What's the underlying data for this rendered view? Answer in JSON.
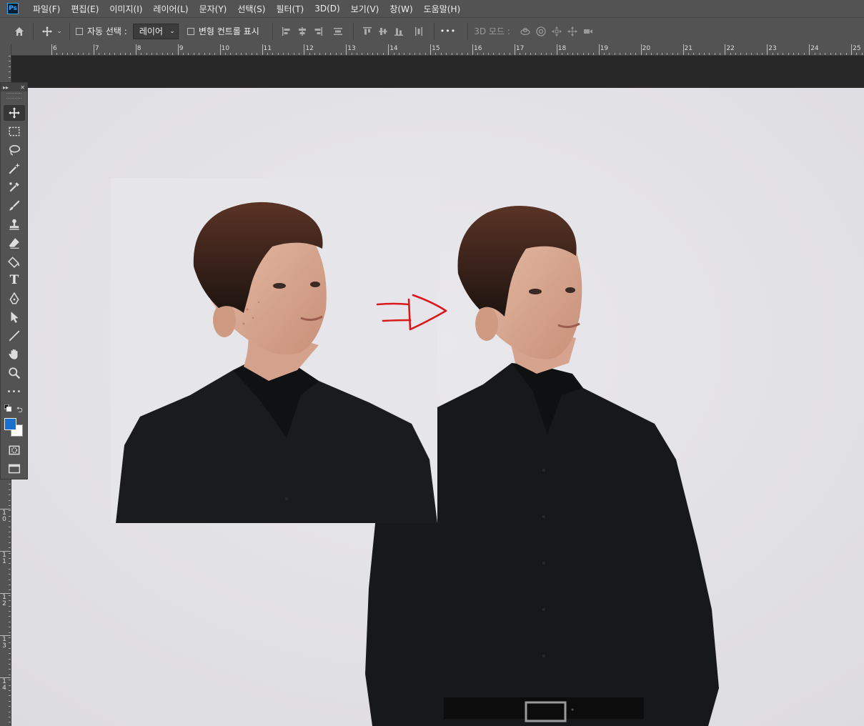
{
  "app": {
    "logo_text": "Ps"
  },
  "menu": [
    "파일(F)",
    "편집(E)",
    "이미지(I)",
    "레이어(L)",
    "문자(Y)",
    "선택(S)",
    "필터(T)",
    "3D(D)",
    "보기(V)",
    "창(W)",
    "도움말(H)"
  ],
  "options": {
    "auto_select_label": "자동 선택 :",
    "auto_select_value": "레이어",
    "transform_controls_label": "변형 컨트롤 표시",
    "mode_3d_label": "3D 모드 :",
    "more_label": "•••"
  },
  "ruler_top": [
    "6",
    "7",
    "8",
    "9",
    "10",
    "11",
    "12",
    "13",
    "14",
    "15",
    "16",
    "17",
    "18",
    "19",
    "20",
    "21",
    "22",
    "23",
    "24",
    "25"
  ],
  "ruler_left": [
    "10",
    "11",
    "12",
    "13",
    "14"
  ],
  "tools": {
    "type_label": "T",
    "more_label": "•••"
  },
  "colors": {
    "foreground": "#1b6fcf",
    "background": "#ffffff",
    "canvas": "#e4e3e6",
    "arrow": "#d9191b"
  }
}
